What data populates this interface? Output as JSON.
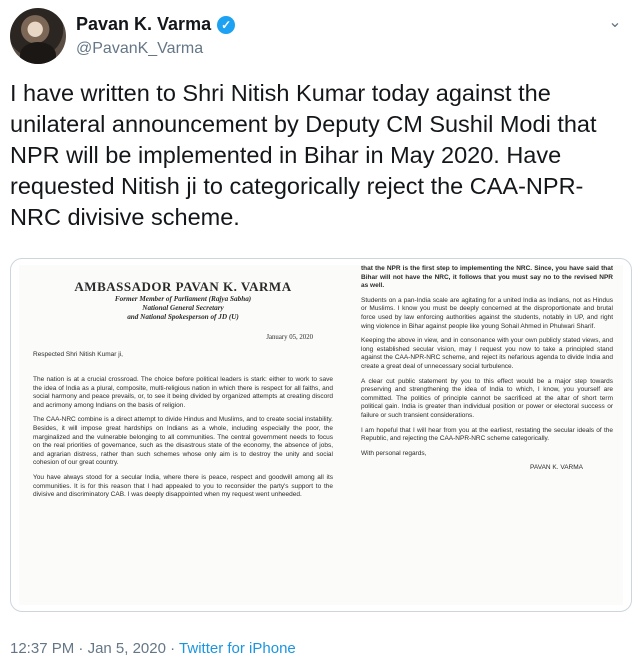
{
  "author": {
    "name": "Pavan K. Varma",
    "handle": "@PavanK_Varma"
  },
  "tweet": {
    "text": "I have written to Shri Nitish Kumar today against the unilateral announcement by Deputy CM Sushil Modi that NPR will be implemented in Bihar in May 2020. Have requested Nitish ji to categorically reject the CAA-NPR-NRC divisive scheme."
  },
  "letter": {
    "title": "AMBASSADOR PAVAN K. VARMA",
    "sub1": "Former Member of Parliament (Rajya Sabha)",
    "sub2": "National General Secretary",
    "sub3": "and National Spokesperson of JD (U)",
    "date": "January 05, 2020",
    "salutation": "Respected Shri Nitish Kumar ji,",
    "p1": "The nation is at a crucial crossroad. The choice before political leaders is stark: either to work to save the idea of India as a plural, composite, multi-religious nation in which there is respect for all faiths, and social harmony and peace prevails, or, to see it being divided by organized attempts at creating discord and acrimony among Indians on the basis of religion.",
    "p2": "The CAA-NRC combine is a direct attempt to divide Hindus and Muslims, and to create social instability. Besides, it will impose great hardships on Indians as a whole, including especially the poor, the marginalized and the vulnerable belonging to all communities. The central government needs to focus on the real priorities of governance, such as the disastrous state of the economy, the absence of jobs, and agrarian distress, rather than such schemes whose only aim is to destroy the unity and social cohesion of our great country.",
    "p3": "You have always stood for a secular India, where there is peace, respect and goodwill among all its communities. It is for this reason that I had appealed to you to reconsider the party's support to the divisive and discriminatory CAB. I was deeply disappointed when my request went unheeded.",
    "r1": "that the NPR is the first step to implementing the NRC. Since, you have said that Bihar will not have the NRC, it follows that you must say no to the revised NPR as well.",
    "r2": "Students on a pan-India scale are agitating for a united India as Indians, not as Hindus or Muslims. I know you must be deeply concerned at the disproportionate and brutal force used by law enforcing authorities against the students, notably in UP, and right wing violence in Bihar against people like young Sohail Ahmed in Phulwari Sharif.",
    "r3": "Keeping the above in view, and in consonance with your own publicly stated views, and long established secular vision, may I request you now to take a principled stand against the CAA-NPR-NRC scheme, and reject its nefarious agenda to divide India and create a great deal of unnecessary social turbulence.",
    "r4": "A clear cut public statement by you to this effect would be a major step towards preserving and strengthening the idea of India to which, I know, you yourself are committed. The politics of principle cannot be sacrificed at the altar of short term political gain. India is greater than individual position or power or electoral success or failure or such transient considerations.",
    "r5": "I am hopeful that I will hear from you at the earliest, restating the secular ideals of the Republic, and rejecting the CAA-NPR-NRC scheme categorically.",
    "closing": "With personal regards,",
    "signature": "PAVAN K. VARMA"
  },
  "footer": {
    "time": "12:37 PM",
    "separator": " · ",
    "date": "Jan 5, 2020",
    "separator2": " · ",
    "source": "Twitter for iPhone"
  },
  "icons": {
    "verified": "verified-badge-icon",
    "more": "chevron-down-icon"
  },
  "colors": {
    "accent": "#1da1f2",
    "link": "#1b95e0",
    "muted": "#657786"
  }
}
